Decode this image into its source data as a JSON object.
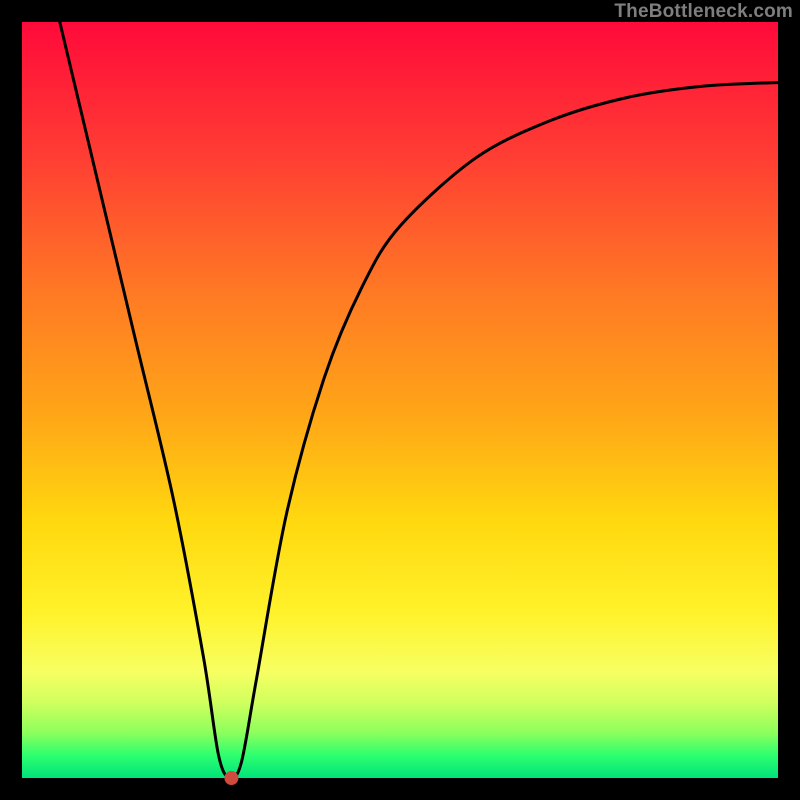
{
  "watermark": "TheBottleneck.com",
  "chart_data": {
    "type": "line",
    "title": "",
    "xlabel": "",
    "ylabel": "",
    "xlim": [
      0,
      100
    ],
    "ylim": [
      0,
      100
    ],
    "grid": false,
    "series": [
      {
        "name": "curve",
        "x": [
          5,
          10,
          15,
          20,
          24,
          26,
          27.5,
          29,
          31,
          35,
          40,
          45,
          50,
          60,
          70,
          80,
          90,
          100
        ],
        "values": [
          100,
          79,
          58,
          37,
          16,
          3,
          0,
          2,
          13,
          35,
          53,
          65,
          73,
          82,
          87,
          90,
          91.5,
          92
        ]
      }
    ],
    "marker": {
      "x": 27.7,
      "y": 0,
      "color": "#d04a3e",
      "radius_px": 7
    }
  }
}
